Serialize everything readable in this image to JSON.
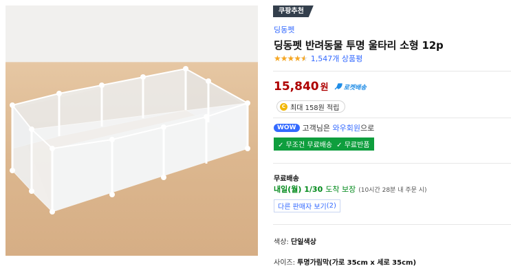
{
  "badge": {
    "label": "쿠팡추천"
  },
  "product": {
    "brand": "딩동펫",
    "title": "딩동펫 반려동물 투명 울타리 소형 12p",
    "rating": 4.5,
    "review_count": "1,547개 상품평",
    "price": "15,840",
    "price_unit": "원",
    "rocket_label": "로켓배송",
    "cash_icon": "C",
    "cash_text": "최대 158원 적립"
  },
  "wow": {
    "badge": "WOW",
    "prefix": "고객님은",
    "link": "와우회원",
    "suffix": "으로",
    "benefits": [
      "✓ 무조건 무료배송",
      "✓ 무료반품"
    ]
  },
  "shipping": {
    "label": "무료배송",
    "date": "내일(월) 1/30",
    "guarantee": "도착 보장",
    "note": "(10시간 28분 내 주문 시)"
  },
  "seller": {
    "button": "다른 판매자 보기",
    "count": "(2)"
  },
  "options": {
    "color_label": "색상:",
    "color_value": "단일색상",
    "size_label": "사이즈:",
    "size_value": "투명가림막(가로 35cm x 세로 35cm)"
  },
  "colors": {
    "accent": "#346aff",
    "price": "#ae0000",
    "rocket": "#1f8ce6",
    "green": "#0e9e3d",
    "badge_bg": "#333f4c"
  }
}
